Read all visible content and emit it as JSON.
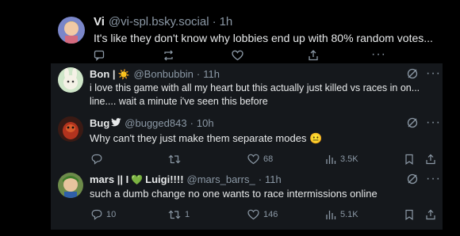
{
  "posts": [
    {
      "name": "Vi",
      "handle": "@vi-spl.bsky.social",
      "time": "1h",
      "text": "It's like they don't know why lobbies end up with 80% random votes...",
      "stats": {
        "reply": "",
        "repost": "",
        "like": "",
        "share": "",
        "more": "···"
      }
    },
    {
      "name": "Bon |",
      "name_suffix": "☀️",
      "handle": "@Bonbubbin",
      "time": "11h",
      "text_lines": [
        "i love this game with all my heart but this actually just killed vs races in on...",
        "line.... wait a minute i've seen this before"
      ],
      "more": "···"
    },
    {
      "name": "Bug",
      "handle": "@bugged843",
      "time": "10h",
      "text": "Why can't they just make them separate modes",
      "emoji": "😐",
      "stats": {
        "reply": "",
        "repost": "",
        "like": "68",
        "views": "3.5K"
      },
      "more": "···"
    },
    {
      "name": "mars || I",
      "name_mid": "💚",
      "name_end": "Luigi!!!!",
      "handle": "@mars_barrs_",
      "time": "11h",
      "text": "such a dumb change no one wants to race intermissions online",
      "stats": {
        "reply": "10",
        "repost": "1",
        "like": "146",
        "views": "5.1K"
      },
      "more": "···"
    }
  ],
  "separator": "·",
  "colors": {
    "background": "#000000",
    "card": "#15181c",
    "muted": "#8b98a5",
    "text": "#e7e9ea",
    "verified": "#1d9bf0"
  }
}
